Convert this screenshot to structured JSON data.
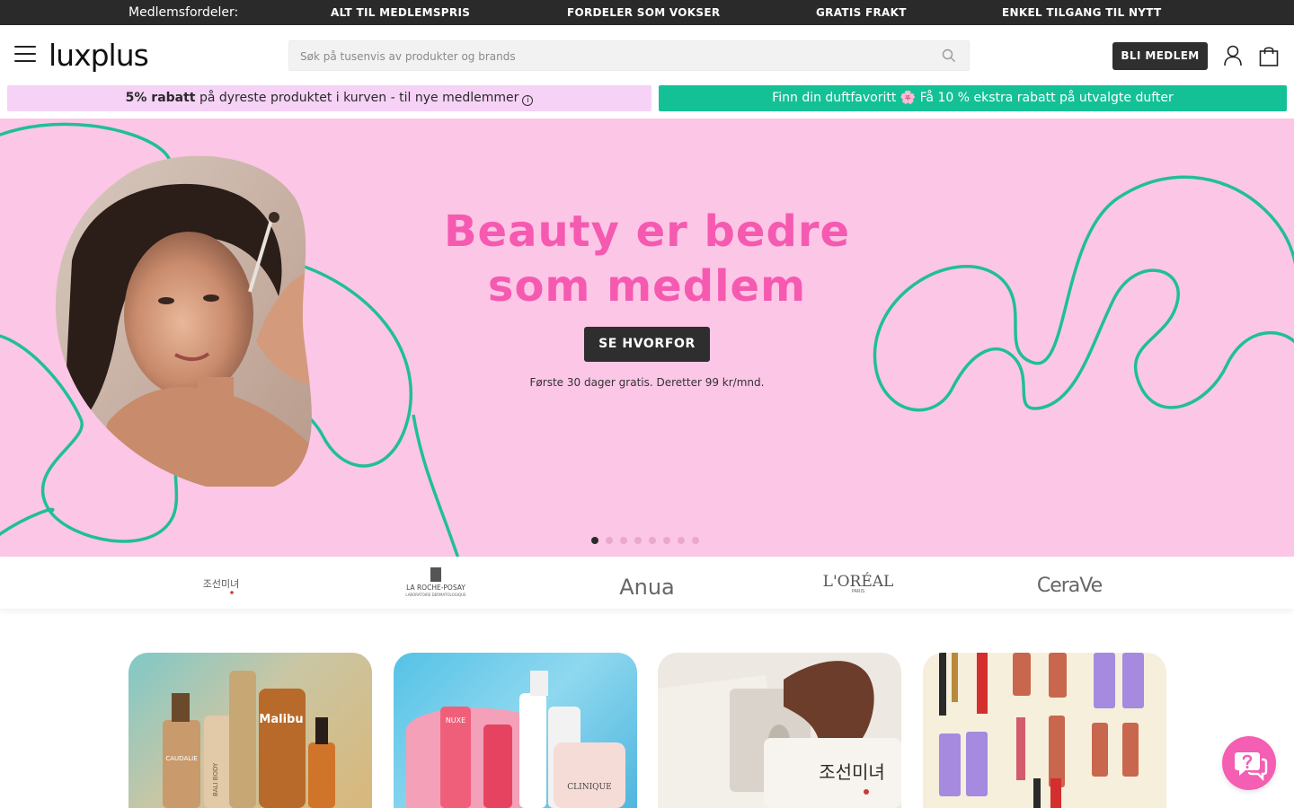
{
  "topbar": {
    "lead": "Medlemsfordeler:",
    "benefits": [
      "ALT TIL MEDLEMSPRIS",
      "FORDELER SOM VOKSER",
      "GRATIS FRAKT",
      "ENKEL TILGANG TIL NYTT"
    ]
  },
  "header": {
    "logo": "luxplus",
    "search_placeholder": "Søk på tusenvis av produkter og brands",
    "join_label": "BLI MEDLEM"
  },
  "promo": {
    "left_bold": "5% rabatt",
    "left_rest": " på dyreste produktet i kurven - til nye medlemmer",
    "info_glyph": "i",
    "right": "Finn din duftfavoritt 🌸 Få 10 % ekstra rabatt på utvalgte dufter"
  },
  "hero": {
    "title_line1": "Beauty er bedre",
    "title_line2": "som medlem",
    "cta": "SE HVORFOR",
    "subtext": "Første 30 dager gratis. Deretter 99 kr/mnd.",
    "slide_count": 8,
    "active_slide": 1,
    "colors": {
      "background": "#fcc6e6",
      "title": "#f55ab0",
      "squiggle": "#1fbf98"
    }
  },
  "brands": {
    "beauty_of_joseon": "조선미녀",
    "la_roche_posay": "LA ROCHE-POSAY",
    "la_roche_posay_sub": "LABORATOIRE DERMATOLOGIQUE",
    "anua": "Anua",
    "loreal": "L'ORÉAL",
    "loreal_sub": "PARIS",
    "cerave": "CeraVe"
  },
  "tiles": {
    "t1_brand_a": "CAUDALIE",
    "t1_brand_b": "Malibu",
    "t1_brand_c": "BALI BODY",
    "t2_brand_a": "NUXE",
    "t2_brand_b": "CLINIQUE",
    "t3_brand_a": "조선미녀"
  },
  "icons": {
    "menu": "menu-icon",
    "search": "search-icon",
    "user": "user-icon",
    "bag": "shopping-bag-icon",
    "chat": "chat-help-icon"
  }
}
